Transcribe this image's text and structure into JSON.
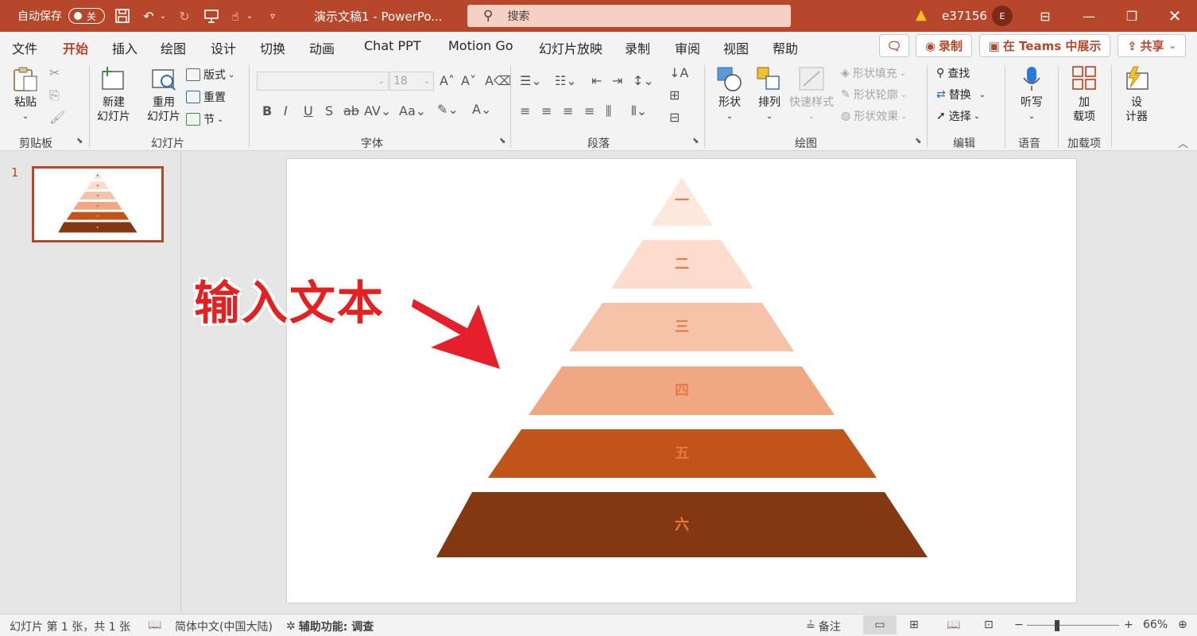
{
  "titlebar": {
    "autosave_label": "自动保存",
    "autosave_state": "关",
    "doc_title": "演示文稿1 - PowerPo...",
    "search_placeholder": "搜索",
    "user_name": "e37156",
    "avatar_initial": "E",
    "accent_color": "#b7472a"
  },
  "menu": {
    "tabs": [
      "文件",
      "开始",
      "插入",
      "绘图",
      "设计",
      "切换",
      "动画",
      "Chat PPT",
      "Motion Go",
      "幻灯片放映",
      "录制",
      "审阅",
      "视图",
      "帮助"
    ],
    "active_tab": "开始",
    "record_label": "录制",
    "teams_label": "在 Teams 中展示",
    "share_label": "共享"
  },
  "ribbon": {
    "clipboard": {
      "paste": "粘贴",
      "group": "剪贴板"
    },
    "slides": {
      "new_slide": "新建\n幻灯片",
      "new_slide_l1": "新建",
      "new_slide_l2": "幻灯片",
      "reuse_l1": "重用",
      "reuse_l2": "幻灯片",
      "layout": "版式",
      "reset": "重置",
      "section": "节",
      "group": "幻灯片"
    },
    "font": {
      "font_size": "18",
      "group": "字体",
      "bold": "B",
      "italic": "I",
      "underline": "U",
      "strike": "S",
      "shadow": "ab"
    },
    "paragraph": {
      "group": "段落"
    },
    "drawing": {
      "shapes": "形状",
      "arrange": "排列",
      "quick_styles": "快速样式",
      "fill": "形状填充",
      "outline": "形状轮廓",
      "effects": "形状效果",
      "group": "绘图"
    },
    "editing": {
      "find": "查找",
      "replace": "替换",
      "select": "选择",
      "group": "编辑"
    },
    "voice": {
      "dictate": "听写",
      "group": "语音"
    },
    "addins": {
      "label_l1": "加",
      "label_l2": "载项",
      "group": "加载项"
    },
    "designer": {
      "label_l1": "设",
      "label_l2": "计器"
    }
  },
  "thumbnail": {
    "number": "1"
  },
  "slide": {
    "callout_text": "输入文本",
    "pyramid_levels": [
      {
        "label": "一",
        "color": "#fde8dd"
      },
      {
        "label": "二",
        "color": "#fbdccd"
      },
      {
        "label": "三",
        "color": "#f5c3a7"
      },
      {
        "label": "四",
        "color": "#f0a882"
      },
      {
        "label": "五",
        "color": "#c05419"
      },
      {
        "label": "六",
        "color": "#843811"
      }
    ],
    "label_color": "#e87a3f",
    "arrow_color": "#e5202b"
  },
  "status": {
    "slide_info": "幻灯片 第 1 张，共 1 张",
    "language": "简体中文(中国大陆)",
    "accessibility": "辅助功能: 调查",
    "notes": "备注",
    "zoom": "66%"
  }
}
